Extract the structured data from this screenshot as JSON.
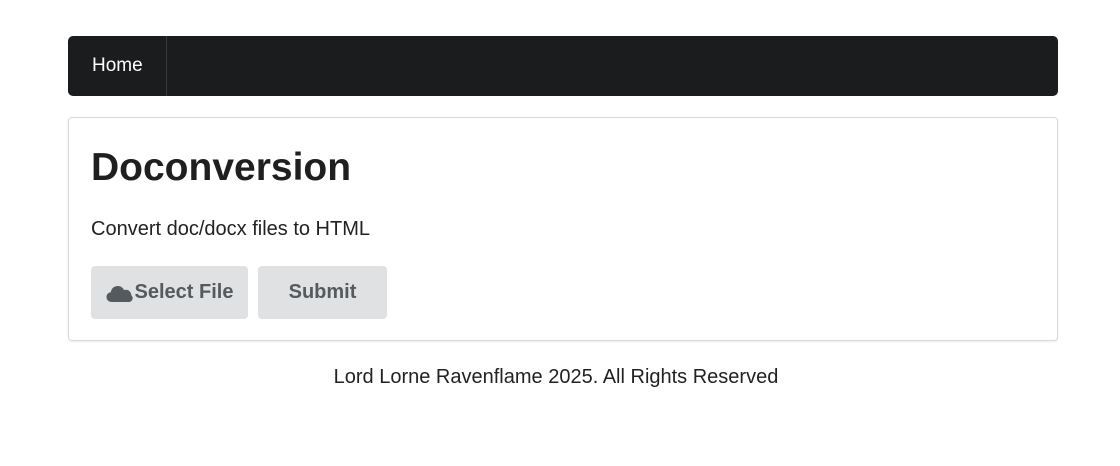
{
  "nav": {
    "items": [
      {
        "label": "Home"
      }
    ]
  },
  "main": {
    "title": "Doconversion",
    "description": "Convert doc/docx files to HTML",
    "select_button": {
      "label": "Select File",
      "icon": "cloud-icon"
    },
    "submit_button": {
      "label": "Submit"
    }
  },
  "footer": {
    "text": "Lord Lorne Ravenflame 2025. All Rights Reserved"
  },
  "colors": {
    "navbar_bg": "#1b1c1d",
    "button_bg": "#e0e1e2",
    "button_text": "#555a5e"
  }
}
